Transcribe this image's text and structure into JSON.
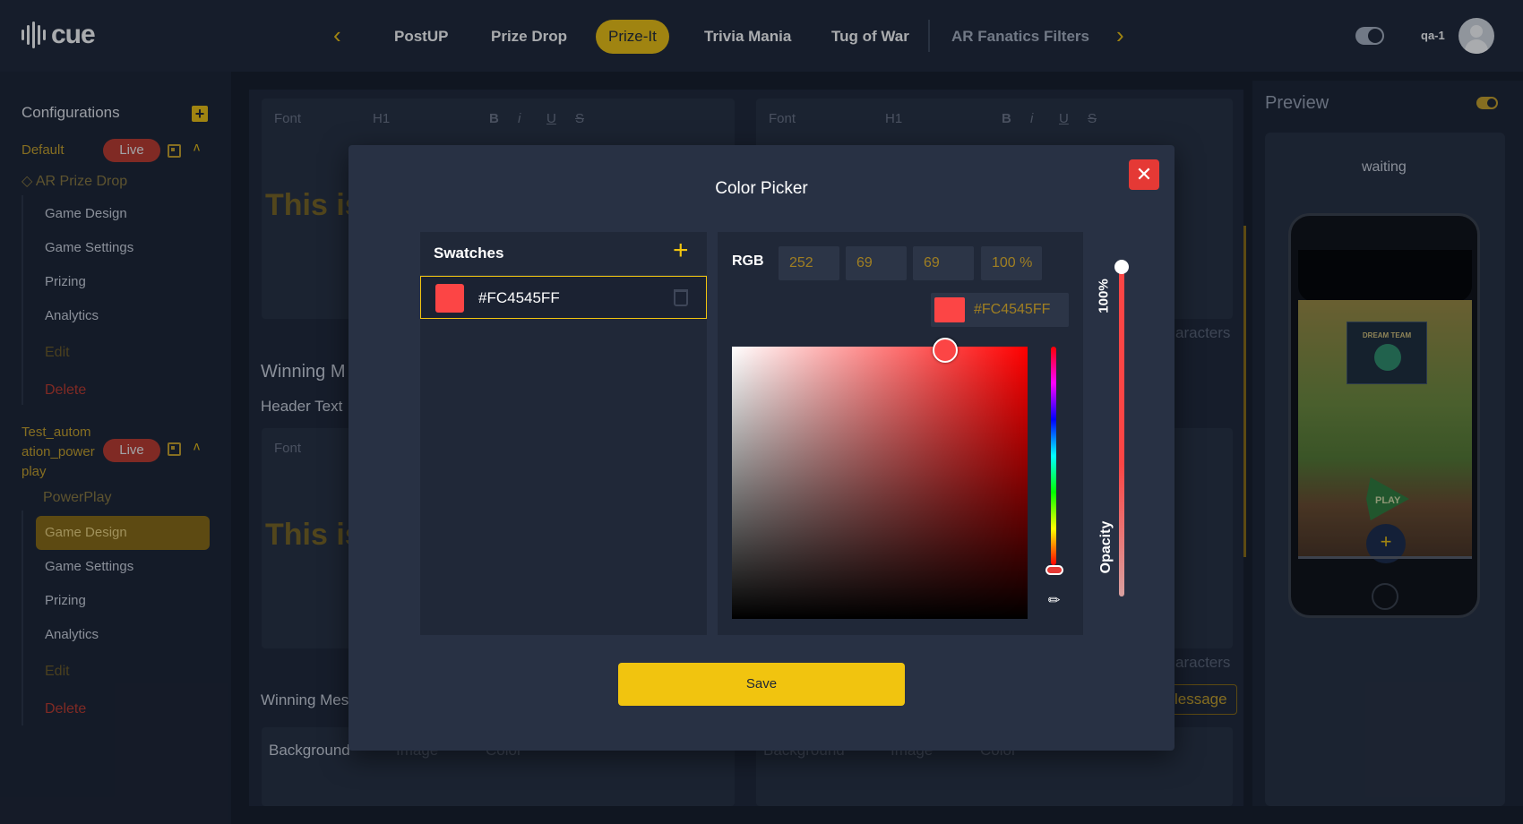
{
  "app": {
    "logo_text": "cue"
  },
  "nav": {
    "tabs": [
      {
        "label": "PostUP"
      },
      {
        "label": "Prize Drop"
      },
      {
        "label": "Prize-It",
        "active": true
      },
      {
        "label": "Trivia Mania"
      },
      {
        "label": "Tug of War"
      },
      {
        "label": "AR Fanatics Filters"
      }
    ],
    "user": "qa-1"
  },
  "sidebar": {
    "title": "Configurations",
    "groups": [
      {
        "name": "Default",
        "status": "Live",
        "sub": "AR Prize Drop",
        "items": [
          "Game Design",
          "Game Settings",
          "Prizing",
          "Analytics",
          "Edit",
          "Delete"
        ]
      },
      {
        "name_lines": [
          "Test_autom",
          "ation_power",
          "play"
        ],
        "status": "Live",
        "sub": "PowerPlay",
        "items": [
          "Game Design",
          "Game Settings",
          "Prizing",
          "Analytics",
          "Edit",
          "Delete"
        ]
      }
    ]
  },
  "editor": {
    "toolbar": {
      "font": "Font",
      "heading": "H1"
    },
    "section_title": "Winning M",
    "header_text_label": "Header Text",
    "ghost_heading": "This is",
    "chars_suffix": "aracters",
    "winning_mes": "Winning Mes",
    "message_btn": "lessage",
    "background_label": "Background",
    "option_image": "Image",
    "option_color": "Color"
  },
  "preview": {
    "title": "Preview",
    "status": "waiting",
    "team_logo_text": "DREAM TEAM",
    "play_label": "PLAY"
  },
  "color_picker": {
    "title": "Color Picker",
    "swatches_title": "Swatches",
    "swatch_hex": "#FC4545FF",
    "mode": "RGB",
    "r": "252",
    "g": "69",
    "b": "69",
    "alpha": "100 %",
    "hex": "#FC4545FF",
    "opacity_value": "100%",
    "opacity_label": "Opacity",
    "save_label": "Save",
    "color": "#fc4545"
  }
}
